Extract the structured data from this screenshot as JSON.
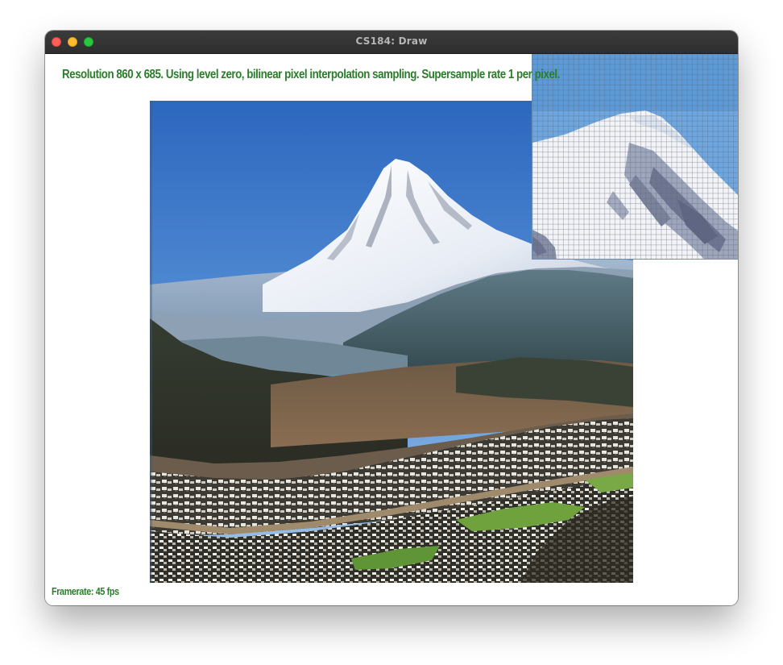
{
  "window": {
    "title": "CS184: Draw"
  },
  "overlay": {
    "status_text": "Resolution 860 x 685. Using level zero, bilinear pixel interpolation sampling. Supersample rate 1 per pixel.",
    "framerate_text": "Framerate: 45 fps"
  },
  "colors": {
    "overlay_text": "#2a7d2a",
    "sky_top": "#2f6fc4",
    "sky_bottom": "#9cc6ee",
    "snow": "#f2f5fa",
    "forest": "#2b3326"
  },
  "icons": {
    "close": "traffic-light-close-icon",
    "minimize": "traffic-light-minimize-icon",
    "maximize": "traffic-light-maximize-icon"
  }
}
